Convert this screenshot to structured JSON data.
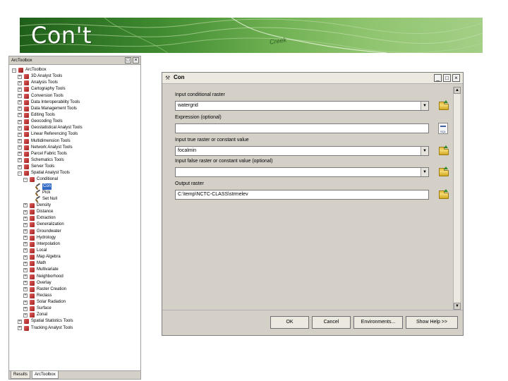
{
  "slide": {
    "title": "Con't",
    "map_label": "Creek"
  },
  "toolbox": {
    "title": "ArcToolbox",
    "title_buttons": [
      "□",
      "×"
    ],
    "tree": [
      {
        "level": 0,
        "expander": "−",
        "icon": "root",
        "label": "ArcToolbox"
      },
      {
        "level": 1,
        "expander": "+",
        "icon": "box",
        "label": "3D Analyst Tools"
      },
      {
        "level": 1,
        "expander": "+",
        "icon": "box",
        "label": "Analysis Tools"
      },
      {
        "level": 1,
        "expander": "+",
        "icon": "box",
        "label": "Cartography Tools"
      },
      {
        "level": 1,
        "expander": "+",
        "icon": "box",
        "label": "Conversion Tools"
      },
      {
        "level": 1,
        "expander": "+",
        "icon": "box",
        "label": "Data Interoperability Tools"
      },
      {
        "level": 1,
        "expander": "+",
        "icon": "box",
        "label": "Data Management Tools"
      },
      {
        "level": 1,
        "expander": "+",
        "icon": "box",
        "label": "Editing Tools"
      },
      {
        "level": 1,
        "expander": "+",
        "icon": "box",
        "label": "Geocoding Tools"
      },
      {
        "level": 1,
        "expander": "+",
        "icon": "box",
        "label": "Geostatistical Analyst Tools"
      },
      {
        "level": 1,
        "expander": "+",
        "icon": "box",
        "label": "Linear Referencing Tools"
      },
      {
        "level": 1,
        "expander": "+",
        "icon": "box",
        "label": "Multidimension Tools"
      },
      {
        "level": 1,
        "expander": "+",
        "icon": "box",
        "label": "Network Analyst Tools"
      },
      {
        "level": 1,
        "expander": "+",
        "icon": "box",
        "label": "Parcel Fabric Tools"
      },
      {
        "level": 1,
        "expander": "+",
        "icon": "box",
        "label": "Schematics Tools"
      },
      {
        "level": 1,
        "expander": "+",
        "icon": "box",
        "label": "Server Tools"
      },
      {
        "level": 1,
        "expander": "−",
        "icon": "box",
        "label": "Spatial Analyst Tools"
      },
      {
        "level": 2,
        "expander": "−",
        "icon": "box",
        "label": "Conditional"
      },
      {
        "level": 3,
        "expander": "",
        "icon": "tool",
        "label": "Con",
        "selected": true
      },
      {
        "level": 3,
        "expander": "",
        "icon": "tool",
        "label": "Pick"
      },
      {
        "level": 3,
        "expander": "",
        "icon": "tool",
        "label": "Set Null"
      },
      {
        "level": 2,
        "expander": "+",
        "icon": "box",
        "label": "Density"
      },
      {
        "level": 2,
        "expander": "+",
        "icon": "box",
        "label": "Distance"
      },
      {
        "level": 2,
        "expander": "+",
        "icon": "box",
        "label": "Extraction"
      },
      {
        "level": 2,
        "expander": "+",
        "icon": "box",
        "label": "Generalization"
      },
      {
        "level": 2,
        "expander": "+",
        "icon": "box",
        "label": "Groundwater"
      },
      {
        "level": 2,
        "expander": "+",
        "icon": "box",
        "label": "Hydrology"
      },
      {
        "level": 2,
        "expander": "+",
        "icon": "box",
        "label": "Interpolation"
      },
      {
        "level": 2,
        "expander": "+",
        "icon": "box",
        "label": "Local"
      },
      {
        "level": 2,
        "expander": "+",
        "icon": "box",
        "label": "Map Algebra"
      },
      {
        "level": 2,
        "expander": "+",
        "icon": "box",
        "label": "Math"
      },
      {
        "level": 2,
        "expander": "+",
        "icon": "box",
        "label": "Multivariate"
      },
      {
        "level": 2,
        "expander": "+",
        "icon": "box",
        "label": "Neighborhood"
      },
      {
        "level": 2,
        "expander": "+",
        "icon": "box",
        "label": "Overlay"
      },
      {
        "level": 2,
        "expander": "+",
        "icon": "box",
        "label": "Raster Creation"
      },
      {
        "level": 2,
        "expander": "+",
        "icon": "box",
        "label": "Reclass"
      },
      {
        "level": 2,
        "expander": "+",
        "icon": "box",
        "label": "Solar Radiation"
      },
      {
        "level": 2,
        "expander": "+",
        "icon": "box",
        "label": "Surface"
      },
      {
        "level": 2,
        "expander": "+",
        "icon": "box",
        "label": "Zonal"
      },
      {
        "level": 1,
        "expander": "+",
        "icon": "box",
        "label": "Spatial Statistics Tools"
      },
      {
        "level": 1,
        "expander": "+",
        "icon": "box",
        "label": "Tracking Analyst Tools"
      }
    ],
    "tabs": [
      {
        "label": "Results",
        "active": false
      },
      {
        "label": "ArcToolbox",
        "active": true
      }
    ]
  },
  "dialog": {
    "title": "Con",
    "title_buttons": [
      "_",
      "□",
      "×"
    ],
    "fields": [
      {
        "label": "Input conditional raster",
        "value": "watergrid",
        "dropdown": true,
        "button": "browse"
      },
      {
        "label": "Expression (optional)",
        "value": "",
        "dropdown": false,
        "button": "sql"
      },
      {
        "label": "Input true raster or constant value",
        "value": "focalmin",
        "dropdown": true,
        "button": "browse"
      },
      {
        "label": "Input false raster or constant value (optional)",
        "value": "",
        "dropdown": true,
        "button": "browse"
      },
      {
        "label": "Output raster",
        "value": "C:\\temp\\NCTC-CLASS\\strmelev",
        "dropdown": false,
        "button": "browse"
      }
    ],
    "sql_button_label": "SQL",
    "buttons": {
      "ok": "OK",
      "cancel": "Cancel",
      "environments": "Environments...",
      "show_help": "Show Help >>"
    },
    "scroll": {
      "up": "▲",
      "down": "▼"
    }
  },
  "colors": {
    "window_bg": "#d4d0c8",
    "selection": "#316ac5",
    "header_green": "#3f8a30"
  }
}
